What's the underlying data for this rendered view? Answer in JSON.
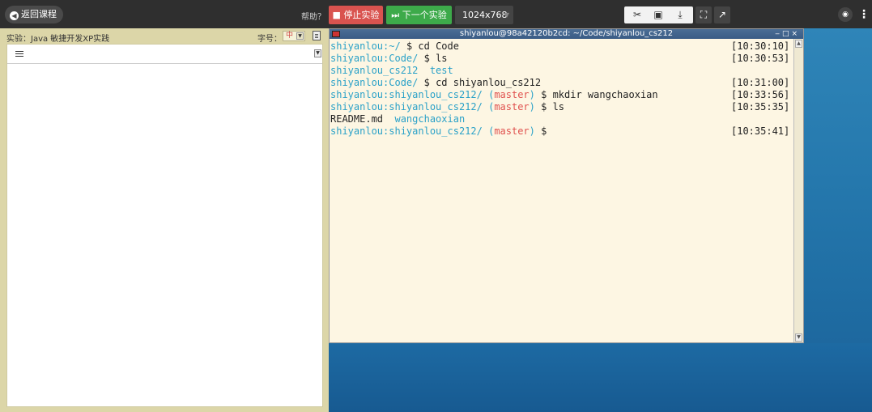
{
  "toolbar": {
    "back_label": "返回课程",
    "help_label": "帮助？",
    "stop_label": "停止实验",
    "next_label": "下一个实验",
    "resolution": "1024x768"
  },
  "left_panel": {
    "lab_title": "实验：Java 敏捷开发XP实践",
    "font_label": "字号：",
    "font_value": "中"
  },
  "terminal": {
    "title": "shiyanlou@98a42120b2cd: ~/Code/shiyanlou_cs212",
    "lines": [
      {
        "segments": [
          {
            "t": "shiyanlou",
            "c": "user"
          },
          {
            "t": ":~/",
            "c": "path"
          },
          {
            "t": " $ cd Code",
            "c": ""
          }
        ],
        "time": "[10:30:10]"
      },
      {
        "segments": [
          {
            "t": "shiyanlou",
            "c": "user"
          },
          {
            "t": ":Code/",
            "c": "path"
          },
          {
            "t": " $ ls",
            "c": ""
          }
        ],
        "time": "[10:30:53]"
      },
      {
        "segments": [
          {
            "t": "shiyanlou_cs212  test",
            "c": "dir"
          }
        ],
        "time": ""
      },
      {
        "segments": [
          {
            "t": "shiyanlou",
            "c": "user"
          },
          {
            "t": ":Code/",
            "c": "path"
          },
          {
            "t": " $ cd shiyanlou_cs212",
            "c": ""
          }
        ],
        "time": "[10:31:00]"
      },
      {
        "segments": [
          {
            "t": "shiyanlou",
            "c": "user"
          },
          {
            "t": ":shiyanlou_cs212/",
            "c": "path"
          },
          {
            "t": " (",
            "c": "path"
          },
          {
            "t": "master",
            "c": "branch"
          },
          {
            "t": ")",
            "c": "path"
          },
          {
            "t": " $ mkdir wangchaoxian",
            "c": ""
          }
        ],
        "time": "[10:33:56]"
      },
      {
        "segments": [
          {
            "t": "shiyanlou",
            "c": "user"
          },
          {
            "t": ":shiyanlou_cs212/",
            "c": "path"
          },
          {
            "t": " (",
            "c": "path"
          },
          {
            "t": "master",
            "c": "branch"
          },
          {
            "t": ")",
            "c": "path"
          },
          {
            "t": " $ ls",
            "c": ""
          }
        ],
        "time": "[10:35:35]"
      },
      {
        "segments": [
          {
            "t": "README.md  ",
            "c": ""
          },
          {
            "t": "wangchaoxian",
            "c": "dir"
          }
        ],
        "time": ""
      },
      {
        "segments": [
          {
            "t": "shiyanlou",
            "c": "user"
          },
          {
            "t": ":shiyanlou_cs212/",
            "c": "path"
          },
          {
            "t": " (",
            "c": "path"
          },
          {
            "t": "master",
            "c": "branch"
          },
          {
            "t": ")",
            "c": "path"
          },
          {
            "t": " $",
            "c": ""
          }
        ],
        "time": "[10:35:41]"
      }
    ]
  },
  "colors": {
    "stop": "#d9534f",
    "next": "#3daa4a",
    "prompt": "#2aa1c8",
    "branch": "#e0524f",
    "terminal_bg": "#fdf6e3"
  },
  "icons": [
    "plus-circle-icon",
    "stop-square-icon",
    "skip-next-icon",
    "scissors-icon",
    "screen-icon",
    "download-icon",
    "fullscreen-icon",
    "external-link-icon",
    "eye-icon",
    "more-icon",
    "list-icon",
    "document-icon"
  ]
}
